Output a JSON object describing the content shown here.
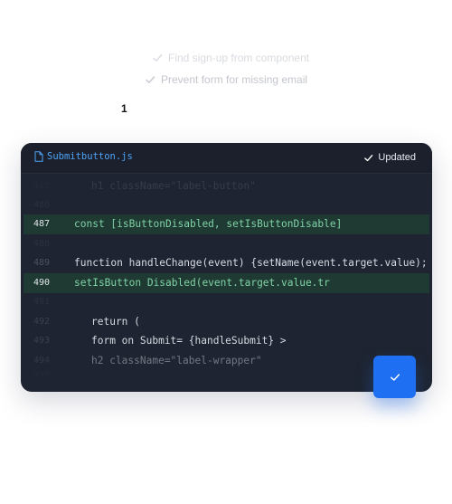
{
  "checklist": {
    "items": [
      {
        "label": "Find sign-up from component"
      },
      {
        "label": "Prevent form  for missing email"
      }
    ],
    "count": "1"
  },
  "editor": {
    "file_name": "Submitbutton.js",
    "status_label": "Updated",
    "lines": [
      {
        "num": "485",
        "text": "h1 className=\"label-button\""
      },
      {
        "num": "486",
        "text": ""
      },
      {
        "num": "487",
        "text": "const [isButtonDisabled, setIsButtonDisable]"
      },
      {
        "num": "488",
        "text": ""
      },
      {
        "num": "489",
        "text": "function handleChange(event) {setName(event.target.value);"
      },
      {
        "num": "490",
        "text": "setIsButton Disabled(event.target.value.tr"
      },
      {
        "num": "491",
        "text": ""
      },
      {
        "num": "492",
        "text": "return ("
      },
      {
        "num": "493",
        "text": "form on Submit= {handleSubmit} >"
      },
      {
        "num": "494",
        "text": "h2 className=\"label-wrapper\""
      },
      {
        "num": "495",
        "text": ""
      }
    ]
  },
  "colors": {
    "accent": "#1f6ff2",
    "editor_bg": "#1e2431",
    "highlight_bg": "#1f3a32",
    "file_name": "#4ea3f7"
  },
  "icons": [
    "check-icon",
    "file-icon",
    "check-icon",
    "checkmark-icon"
  ]
}
